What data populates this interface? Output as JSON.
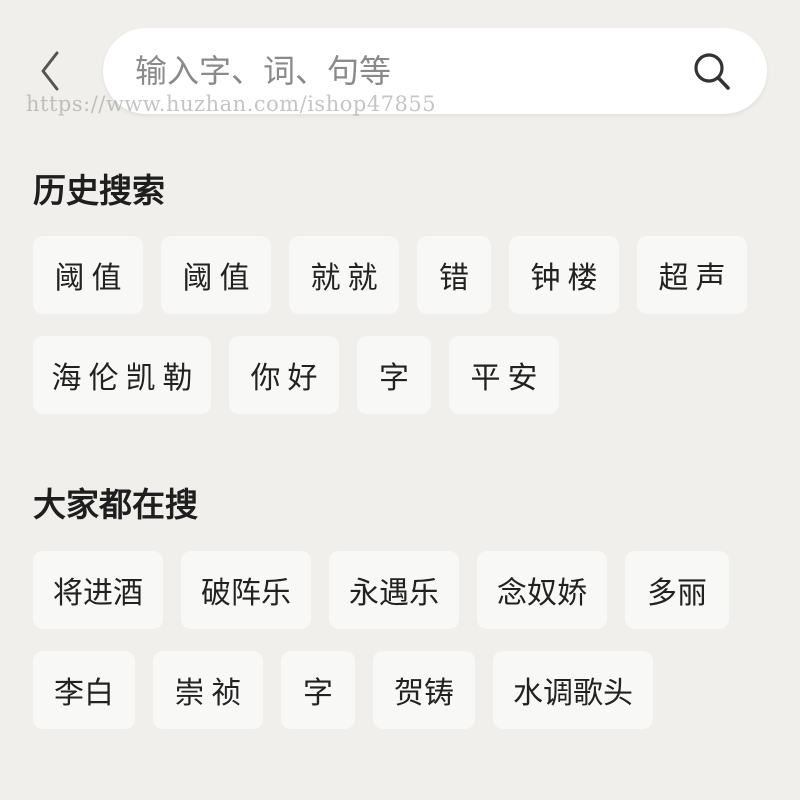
{
  "header": {
    "search_placeholder": "输入字、词、句等",
    "watermark": "https://www.huzhan.com/ishop47855"
  },
  "history": {
    "title": "历史搜索",
    "items": [
      "阈值",
      "阈值",
      "就就",
      "错",
      "钟楼",
      "超声",
      "海伦凯勒",
      "你好",
      "字",
      "平安"
    ]
  },
  "popular": {
    "title": "大家都在搜",
    "items": [
      "将进酒",
      "破阵乐",
      "永遇乐",
      "念奴娇",
      "多丽",
      "李白",
      "崇祯",
      "字",
      "贺铸",
      "水调歌头"
    ]
  },
  "icons": {
    "back": "chevron-left-icon",
    "search": "search-icon"
  },
  "colors": {
    "background": "#f0efec",
    "chip": "#f8f8f7",
    "search_box": "#ffffff",
    "text": "#222222",
    "placeholder": "#8a8a8a"
  }
}
